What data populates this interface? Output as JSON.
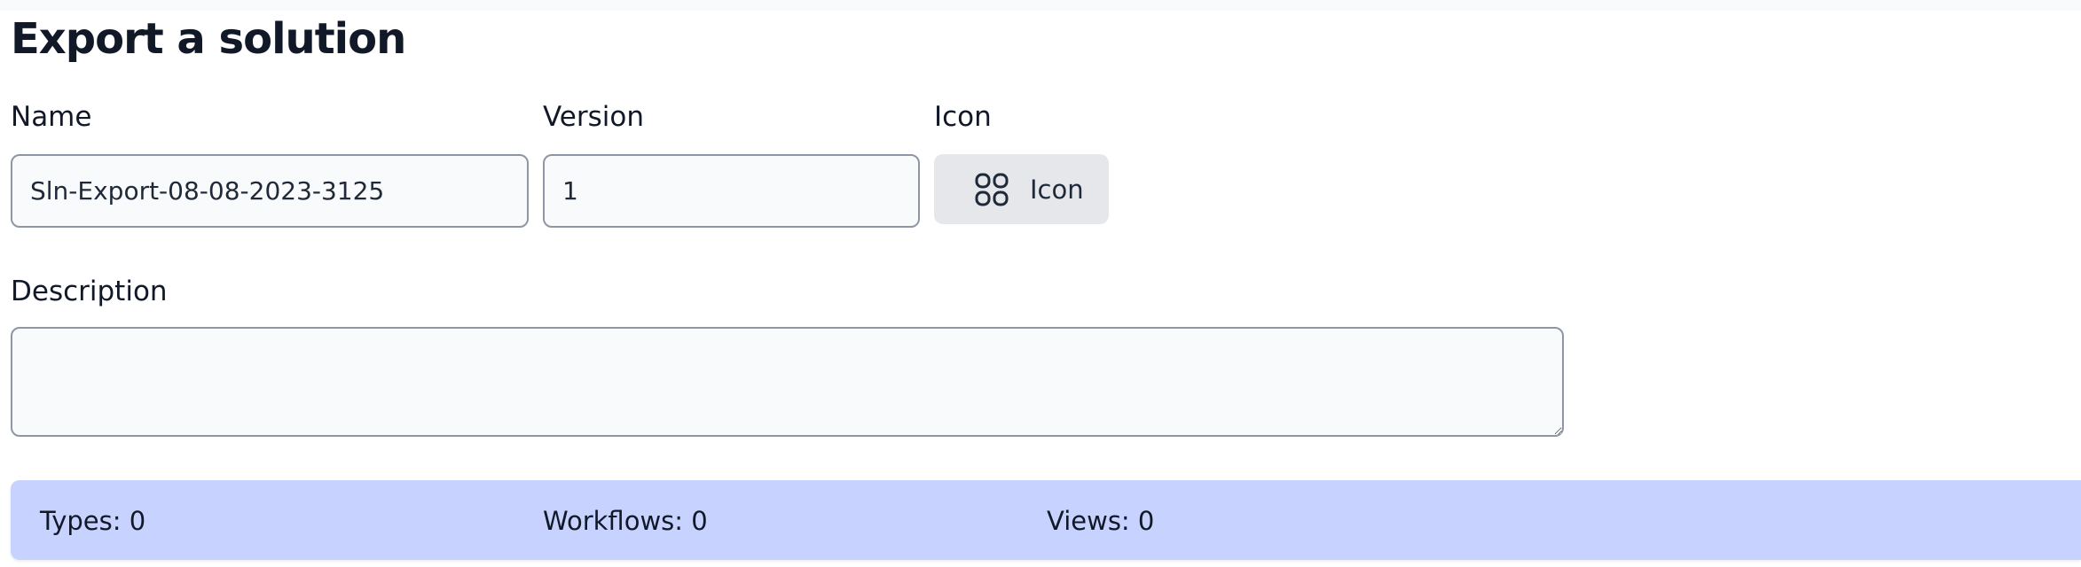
{
  "page": {
    "title": "Export a solution"
  },
  "form": {
    "name_label": "Name",
    "name_value": "Sln-Export-08-08-2023-3125",
    "version_label": "Version",
    "version_value": "1",
    "icon_label": "Icon",
    "icon_button_label": "Icon",
    "icon_button_icon": "apps-grid-icon",
    "description_label": "Description",
    "description_value": ""
  },
  "summary": {
    "types": "Types: 0",
    "workflows": "Workflows: 0",
    "views": "Views: 0"
  },
  "colors": {
    "summary_bar": "#c7d2fe",
    "field_background": "#f9fafb",
    "field_border": "#8f96a5",
    "icon_button_background": "#e5e7eb"
  }
}
